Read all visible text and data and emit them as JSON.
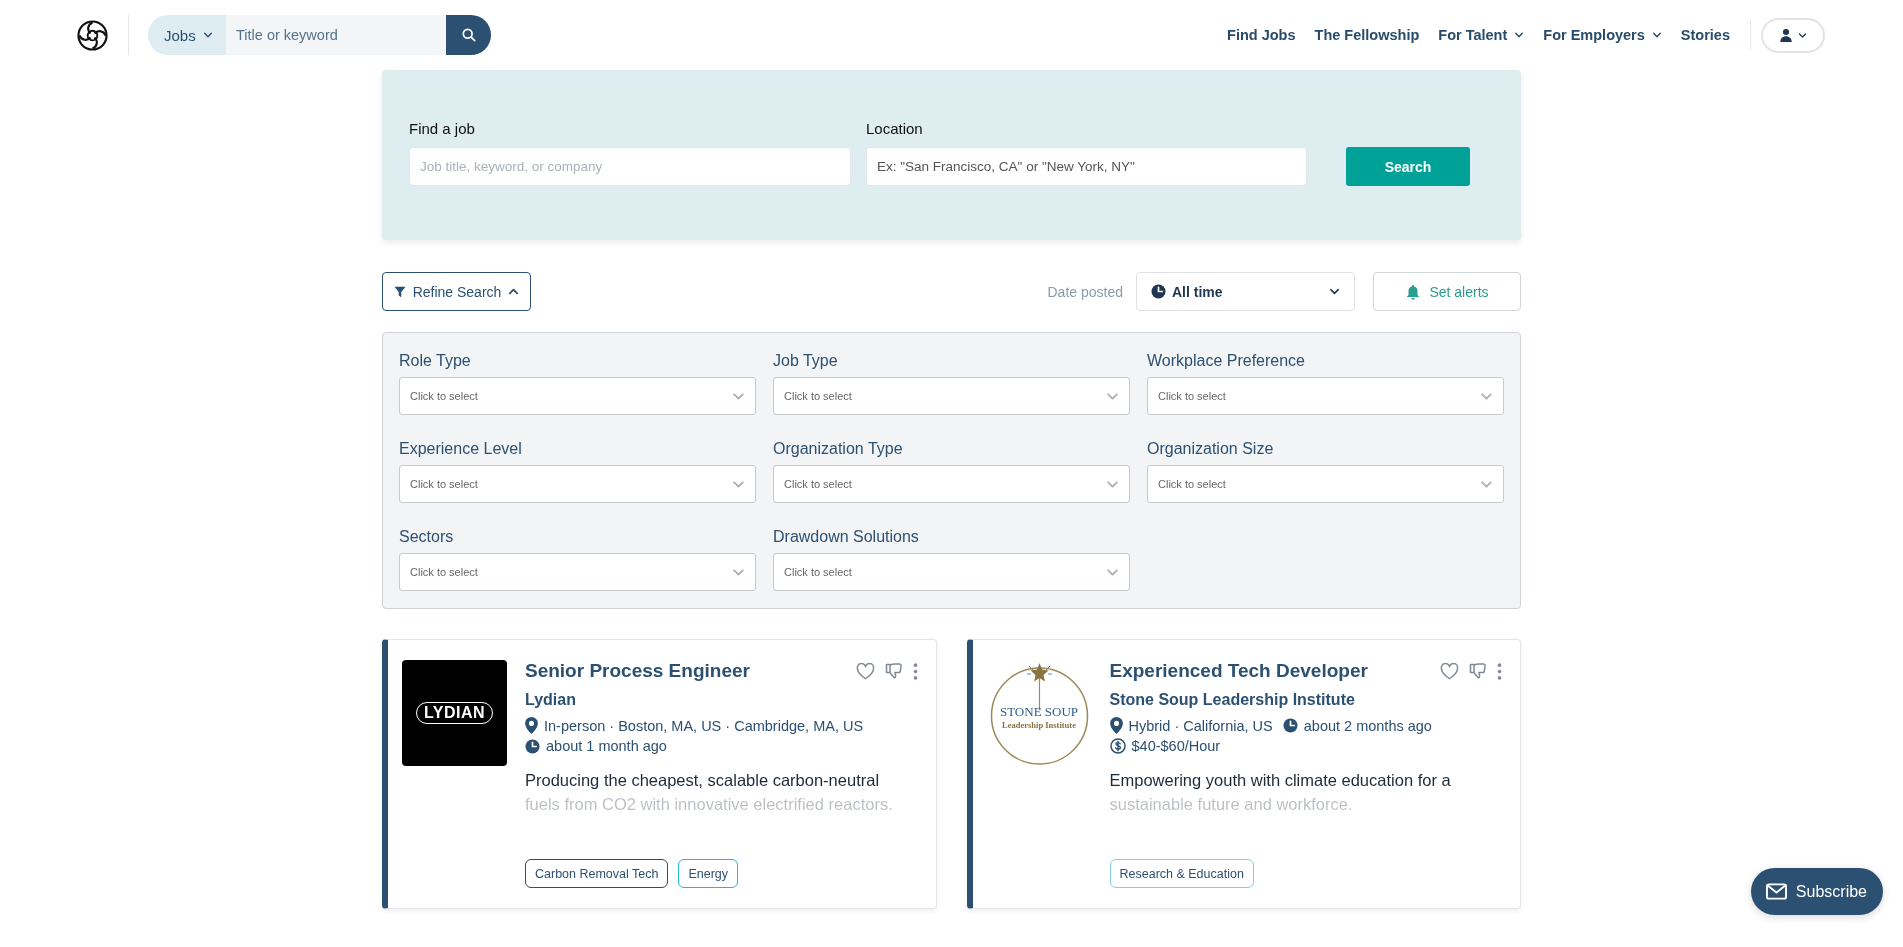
{
  "header": {
    "scope": "Jobs",
    "search_placeholder": "Title or keyword",
    "links": [
      {
        "label": "Find Jobs",
        "dropdown": false
      },
      {
        "label": "The Fellowship",
        "dropdown": false
      },
      {
        "label": "For Talent",
        "dropdown": true
      },
      {
        "label": "For Employers",
        "dropdown": true
      },
      {
        "label": "Stories",
        "dropdown": false
      }
    ]
  },
  "search_panel": {
    "fields": [
      {
        "label": "Find a job",
        "placeholder": "Job title, keyword, or company"
      },
      {
        "label": "Location",
        "placeholder": "Ex: \"San Francisco, CA\" or \"New York, NY\""
      }
    ],
    "button": "Search"
  },
  "toolbar": {
    "refine": {
      "label": "Refine Search",
      "expanded": true
    },
    "date_label": "Date posted",
    "date_value": "All time",
    "alerts_button": "Set alerts"
  },
  "filters": [
    {
      "label": "Role Type",
      "placeholder": "Click to select"
    },
    {
      "label": "Job Type",
      "placeholder": "Click to select"
    },
    {
      "label": "Workplace Preference",
      "placeholder": "Click to select"
    },
    {
      "label": "Experience Level",
      "placeholder": "Click to select"
    },
    {
      "label": "Organization Type",
      "placeholder": "Click to select"
    },
    {
      "label": "Organization Size",
      "placeholder": "Click to select"
    },
    {
      "label": "Sectors",
      "placeholder": "Click to select"
    },
    {
      "label": "Drawdown Solutions",
      "placeholder": "Click to select"
    }
  ],
  "jobs": [
    {
      "title": "Senior Process Engineer",
      "company": "Lydian",
      "logo": {
        "kind": "wordmark",
        "lines": [
          "LYDIAN"
        ]
      },
      "meta": [
        [
          {
            "kind": "location",
            "text": "In-person · Boston, MA, US · Cambridge, MA, US"
          }
        ],
        [
          {
            "kind": "time",
            "text": "about 1 month ago"
          }
        ]
      ],
      "description": "Producing the cheapest, scalable carbon-neutral fuels from CO2 with innovative electrified reactors.",
      "tags": [
        {
          "label": "Carbon Removal Tech",
          "color": "#2b5071"
        },
        {
          "label": "Energy",
          "color": "#27b5d8"
        }
      ]
    },
    {
      "title": "Experienced Tech Developer",
      "company": "Stone Soup Leadership Institute",
      "logo": {
        "kind": "emblem",
        "lines": [
          "STONE SOUP",
          "Leadership Institute"
        ]
      },
      "meta": [
        [
          {
            "kind": "location",
            "text": "Hybrid · California, US"
          },
          {
            "kind": "time",
            "text": "about 2 months ago"
          }
        ],
        [
          {
            "kind": "salary",
            "text": "$40-$60/Hour"
          }
        ]
      ],
      "description": "Empowering youth with climate education for a sustainable future and workforce.",
      "tags": [
        {
          "label": "Research & Education",
          "color": "#7fd0e0"
        }
      ]
    }
  ],
  "subscribe": "Subscribe"
}
